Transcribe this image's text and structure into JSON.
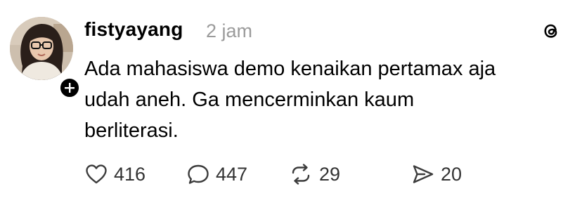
{
  "post": {
    "username": "fistyayang",
    "timestamp": "2 jam",
    "text_lines": [
      "Ada mahasiswa demo kenaikan pertamax aja",
      "udah aneh. Ga mencerminkan kaum",
      "berliterasi."
    ],
    "icons": {
      "brand": "threads-logo-icon",
      "follow": "plus-icon",
      "like": "heart-icon",
      "reply": "comment-bubble-icon",
      "repost": "repost-arrows-icon",
      "share": "send-icon"
    },
    "stats": {
      "likes": "416",
      "replies": "447",
      "reposts": "29",
      "shares": "20"
    }
  }
}
